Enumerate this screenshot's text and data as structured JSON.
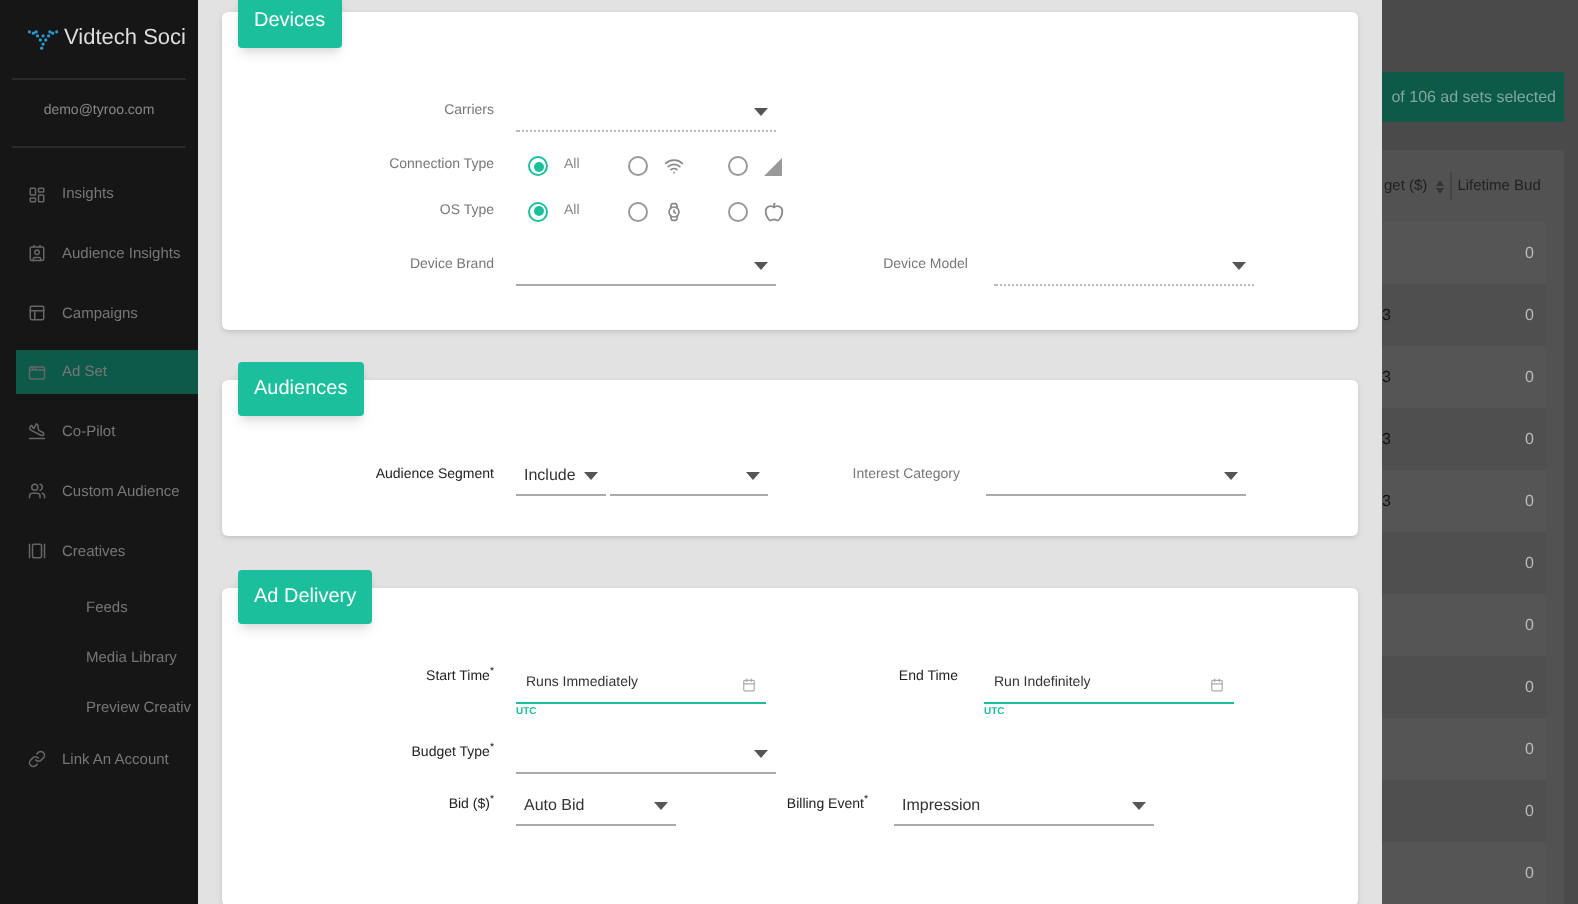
{
  "sidebar": {
    "brand": "Vidtech Soci",
    "user": "demo@tyroo.com",
    "items": [
      {
        "label": "Insights",
        "selected": false
      },
      {
        "label": "Audience Insights",
        "selected": false
      },
      {
        "label": "Campaigns",
        "selected": false
      },
      {
        "label": "Ad Set",
        "selected": true
      },
      {
        "label": "Co-Pilot",
        "selected": false
      },
      {
        "label": "Custom Audience",
        "selected": false
      },
      {
        "label": "Creatives",
        "selected": false,
        "children": [
          {
            "label": "Feeds",
            "selected": false
          },
          {
            "label": "Media Library",
            "selected": false
          },
          {
            "label": "Preview Creativ",
            "selected": false
          }
        ]
      },
      {
        "label": "Link An Account",
        "selected": false
      }
    ]
  },
  "modal": {
    "sections": [
      {
        "title": "Devices",
        "rows": [
          {
            "fields": [
              {
                "kind": "select",
                "label": "Carriers",
                "disabled": true
              }
            ]
          },
          {
            "fields": [
              {
                "kind": "radio",
                "label": "Connection Type",
                "options": [
                  {
                    "label": "All",
                    "selected": true
                  },
                  {
                    "selected": false
                  },
                  {
                    "selected": false
                  }
                ]
              }
            ]
          },
          {
            "fields": [
              {
                "kind": "radio",
                "label": "OS Type",
                "options": [
                  {
                    "label": "All",
                    "selected": true
                  },
                  {
                    "selected": false
                  },
                  {
                    "selected": false
                  }
                ]
              }
            ]
          },
          {
            "fields": [
              {
                "kind": "select",
                "label": "Device Brand",
                "disabled": false
              },
              {
                "kind": "select",
                "label": "Device Model",
                "disabled": true
              }
            ]
          }
        ]
      },
      {
        "title": "Audiences",
        "rows": [
          {
            "fields": [
              {
                "kind": "select_pair",
                "label": "Audience Segment",
                "selects": [
                  {
                    "value": "Include"
                  },
                  {
                    "disabled": false
                  }
                ]
              },
              {
                "kind": "select",
                "label": "Interest Category",
                "disabled": false
              }
            ]
          }
        ]
      },
      {
        "title": "Ad Delivery",
        "rows": [
          {
            "fields": [
              {
                "kind": "date",
                "label": "Start Time$^{*}$",
                "value": "Runs Immediately",
                "hint": "UTC"
              },
              {
                "kind": "date",
                "label": "End Time",
                "value": "Run Indefinitely",
                "hint": "UTC"
              }
            ]
          },
          {
            "fields": [
              {
                "kind": "select",
                "label": "Budget Type$^{*}$",
                "disabled": false
              }
            ]
          },
          {
            "fields": [
              {
                "kind": "select",
                "label": "Bid ($)$^{*}$",
                "value": "Auto Bid",
                "disabled": false
              },
              {
                "kind": "select",
                "label": "Billing Event$^{*}$",
                "value": "Impression",
                "disabled": false
              }
            ]
          }
        ]
      }
    ]
  },
  "background": {
    "banner": "of 106 ad sets selected",
    "table": {
      "columns": [
        "get ($)",
        "Lifetime Bud"
      ],
      "rows": [
        [
          "",
          "0"
        ],
        [
          "3",
          "0"
        ],
        [
          "3",
          "0"
        ],
        [
          "3",
          "0"
        ],
        [
          "3",
          "0"
        ],
        [
          "",
          "0"
        ],
        [
          "",
          "0"
        ],
        [
          "",
          "0"
        ],
        [
          "",
          "0"
        ],
        [
          "",
          "0"
        ],
        [
          "",
          "0"
        ]
      ]
    }
  }
}
